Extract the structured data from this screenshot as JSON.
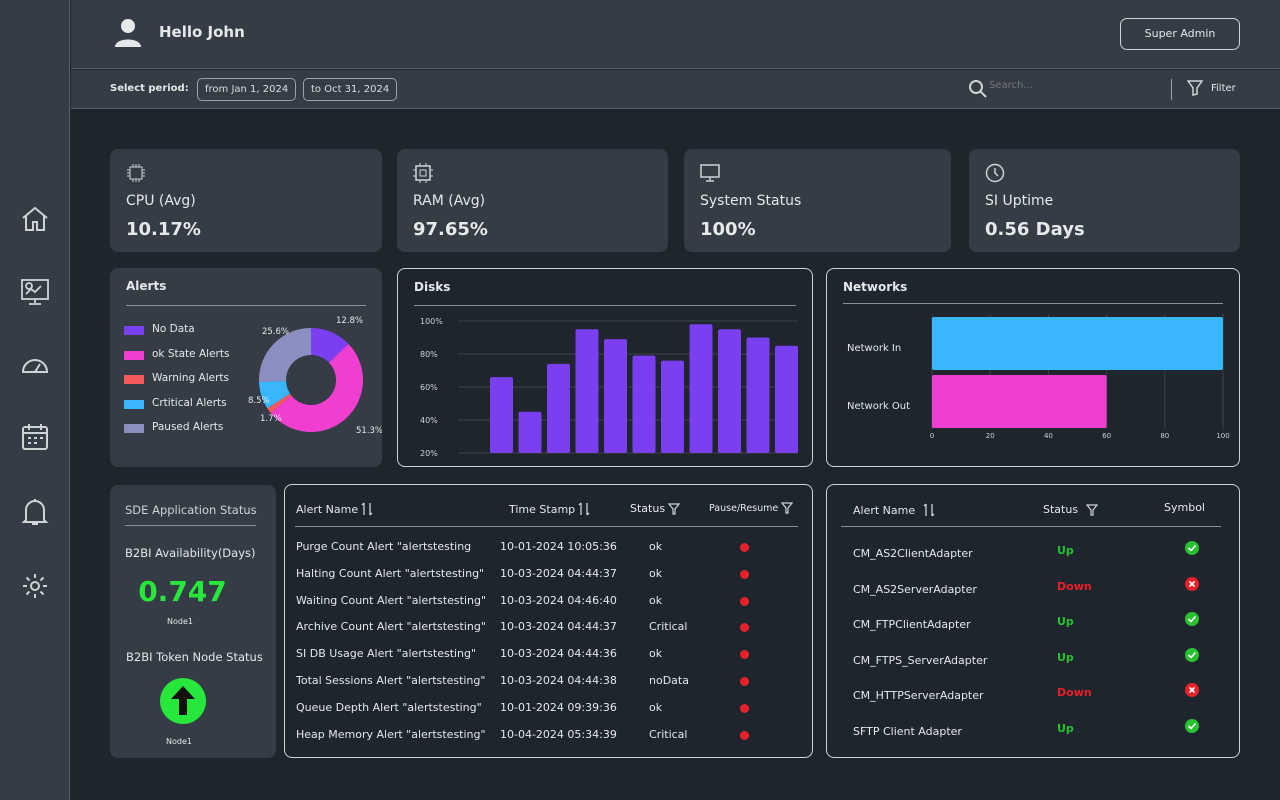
{
  "header": {
    "greeting": "Hello John",
    "role_button": "Super Admin"
  },
  "period": {
    "label": "Select period:",
    "from": "from Jan 1, 2024",
    "to": "to Oct 31, 2024",
    "search_placeholder": "Search...",
    "filter_label": "Filter"
  },
  "sidebar": {
    "items": [
      {
        "icon": "home-icon"
      },
      {
        "icon": "monitor-chart-icon"
      },
      {
        "icon": "speedometer-icon"
      },
      {
        "icon": "calendar-icon"
      },
      {
        "icon": "bell-icon"
      },
      {
        "icon": "gear-icon"
      }
    ]
  },
  "stats": [
    {
      "label": "CPU (Avg)",
      "value": "10.17%",
      "icon": "cpu-icon"
    },
    {
      "label": "RAM (Avg)",
      "value": "97.65%",
      "icon": "chip-icon"
    },
    {
      "label": "System Status",
      "value": "100%",
      "icon": "monitor-icon"
    },
    {
      "label": "SI Uptime",
      "value": "0.56 Days",
      "icon": "clock-icon"
    }
  ],
  "chart_data": [
    {
      "type": "pie",
      "title": "Alerts",
      "donut": true,
      "legend_placement": "left",
      "categories": [
        "No Data",
        "ok State Alerts",
        "Warning Alerts",
        "Crtitical Alerts",
        "Paused Alerts"
      ],
      "values": [
        12.8,
        51.3,
        1.7,
        8.5,
        25.6
      ],
      "labels": [
        "12.8%",
        "51.3%",
        "1.7%",
        "8.5%",
        "25.6%"
      ],
      "colors": [
        "#7a3ff0",
        "#f03fd0",
        "#f55a5a",
        "#38b6ff",
        "#8a8fc0"
      ]
    },
    {
      "type": "bar",
      "title": "Disks",
      "ylim": [
        20,
        100
      ],
      "yticks": [
        "20%",
        "40%",
        "60%",
        "80%",
        "100%"
      ],
      "ytick_values": [
        20,
        40,
        60,
        80,
        100
      ],
      "values": [
        66,
        45,
        74,
        95,
        89,
        79,
        76,
        98,
        95,
        90,
        85
      ],
      "color": "#7a3ff0",
      "grid": true
    },
    {
      "type": "bar",
      "orientation": "horizontal",
      "title": "Networks",
      "categories": [
        "Network In",
        "Network Out"
      ],
      "values": [
        100,
        60
      ],
      "colors": [
        "#38b6ff",
        "#f03fd0"
      ],
      "xlim": [
        0,
        100
      ],
      "xticks": [
        "0",
        "20",
        "40",
        "60",
        "80",
        "100"
      ],
      "xtick_values": [
        0,
        20,
        40,
        60,
        80,
        100
      ],
      "grid": true
    }
  ],
  "sde": {
    "title": "SDE Application Status",
    "availability_label": "B2BI Availability(Days)",
    "availability_value": "0.747",
    "node1": "Node1",
    "token_label": "B2BI Token Node Status",
    "node2": "Node1",
    "accent": "#27e83a"
  },
  "alerts_table": {
    "columns": [
      "Alert Name",
      "Time Stamp",
      "Status",
      "Pause/Resume"
    ],
    "rows": [
      [
        "Purge Count Alert \"alertstesting",
        "10-01-2024 10:05:36",
        "ok"
      ],
      [
        "Halting Count Alert \"alertstesting\"",
        "10-03-2024 04:44:37",
        "ok"
      ],
      [
        "Waiting Count Alert \"alertstesting\"",
        "10-03-2024 04:46:40",
        "ok"
      ],
      [
        "Archive Count Alert \"alertstesting\"",
        "10-03-2024 04:44:37",
        "Critical"
      ],
      [
        "SI DB Usage Alert \"alertstesting\"",
        "10-03-2024 04:44:36",
        "ok"
      ],
      [
        "Total Sessions Alert \"alertstesting\"",
        "10-03-2024 04:44:38",
        "noData"
      ],
      [
        "Queue Depth Alert \"alertstesting\"",
        "10-01-2024 09:39:36",
        "ok"
      ],
      [
        "Heap Memory Alert \"alertstesting\"",
        "10-04-2024 05:34:39",
        "Critical"
      ]
    ]
  },
  "adapters_table": {
    "columns": [
      "Alert Name",
      "Status",
      "Symbol"
    ],
    "rows": [
      [
        "CM_AS2ClientAdapter",
        "Up"
      ],
      [
        "CM_AS2ServerAdapter",
        "Down"
      ],
      [
        "CM_FTPClientAdapter",
        "Up"
      ],
      [
        "CM_FTPS_ServerAdapter",
        "Up"
      ],
      [
        "CM_HTTPServerAdapter",
        "Down"
      ],
      [
        "SFTP Client Adapter",
        "Up"
      ]
    ],
    "up_color": "#27c22e",
    "down_color": "#e8202a"
  }
}
